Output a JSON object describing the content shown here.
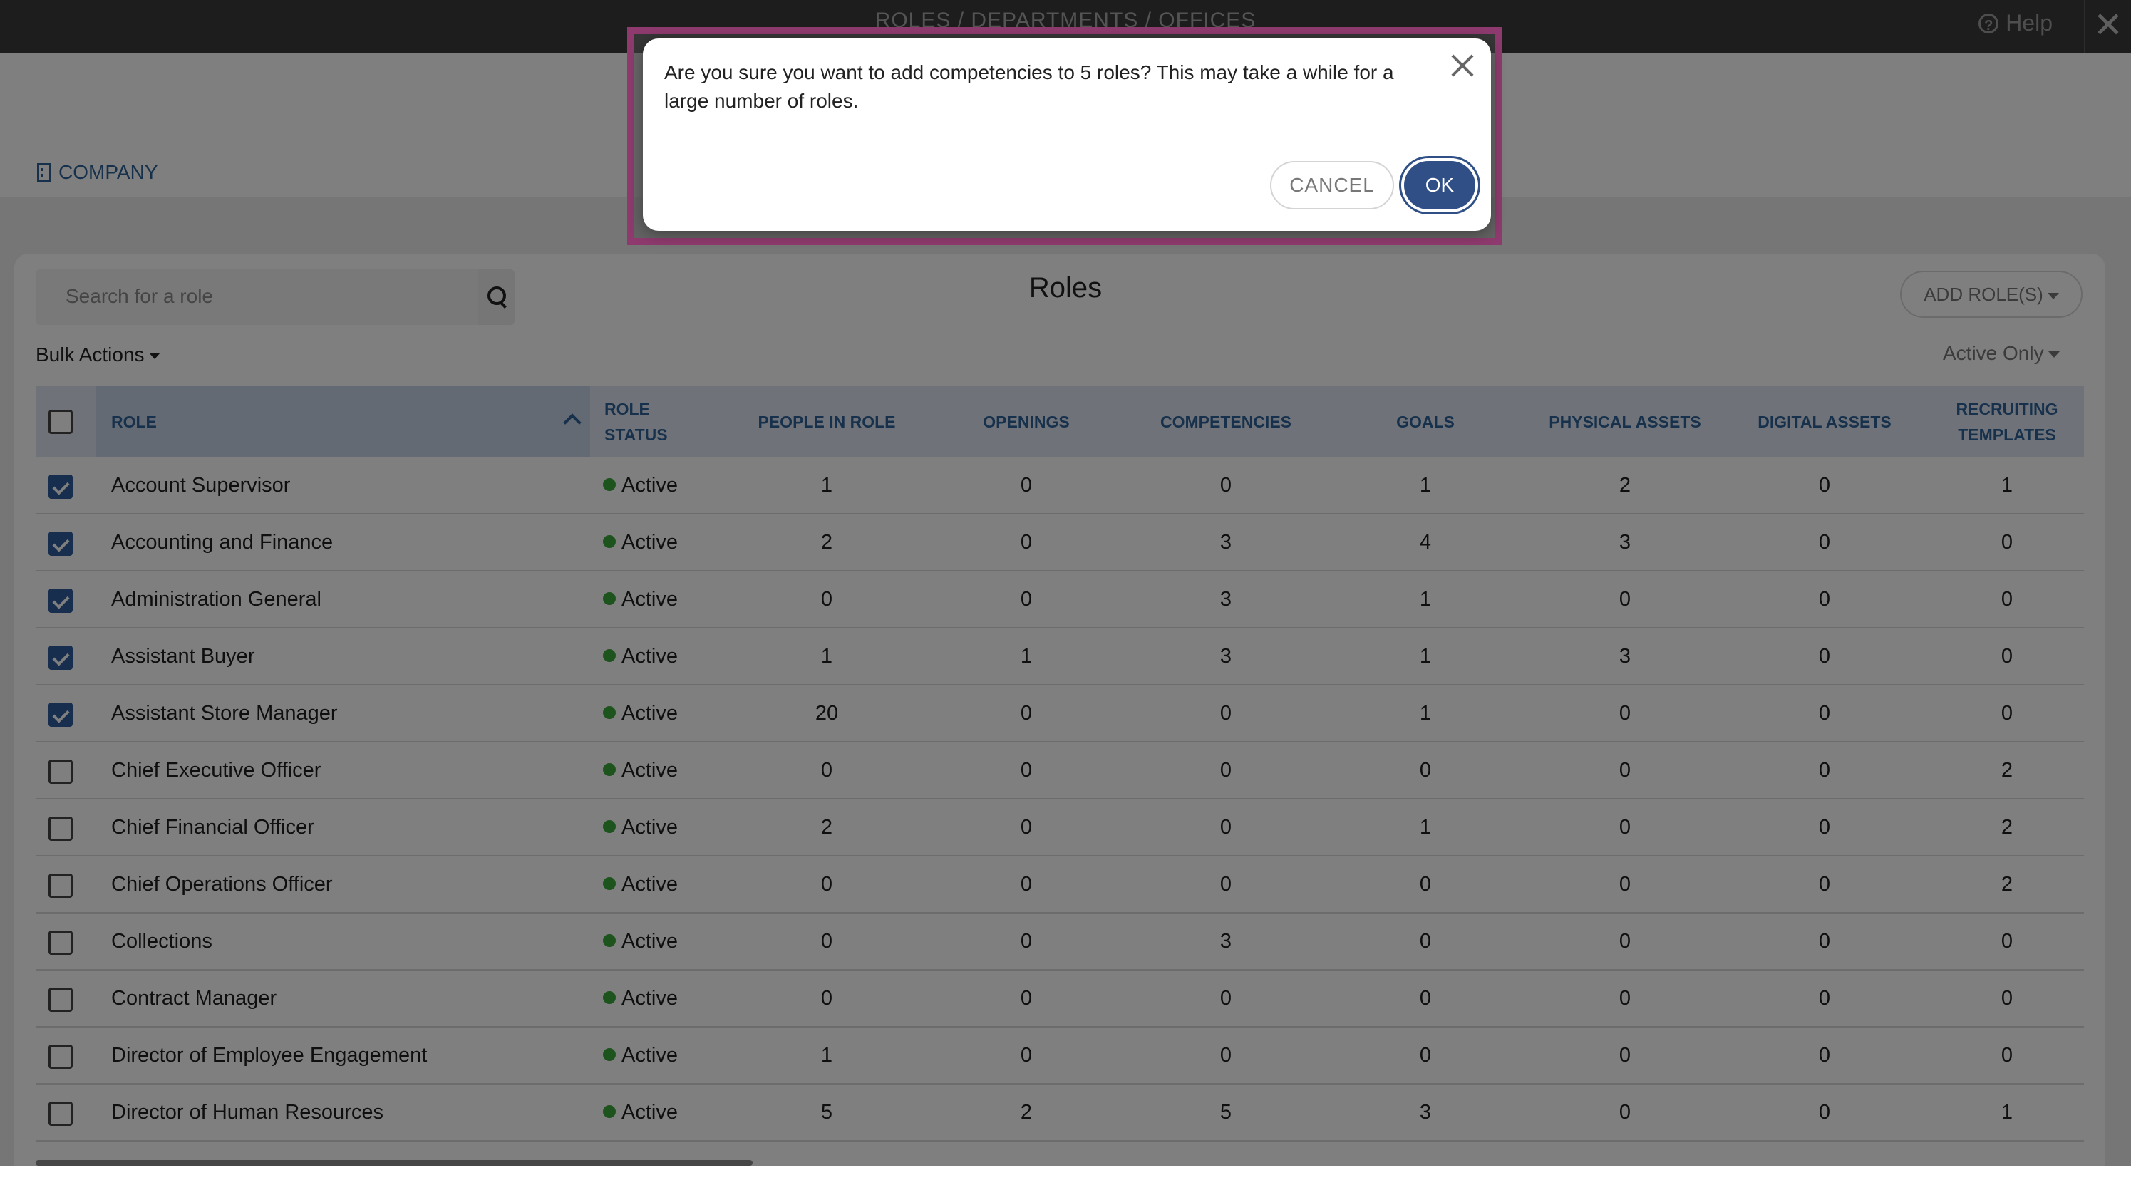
{
  "window": {
    "title": "ROLES / DEPARTMENTS / OFFICES",
    "help_label": "Help",
    "close_glyph": "✕"
  },
  "company_bar": {
    "label": "COMPANY",
    "icon": "building-icon"
  },
  "search": {
    "placeholder": "Search for a role",
    "icon": "search-icon"
  },
  "main": {
    "title": "Roles",
    "add_role_label": "ADD ROLE(S)",
    "bulk_actions_label": "Bulk Actions",
    "filter_label": "Active Only"
  },
  "table": {
    "headers": {
      "role": "ROLE",
      "role_status": "ROLE STATUS",
      "people_in_role": "PEOPLE IN ROLE",
      "openings": "OPENINGS",
      "competencies": "COMPETENCIES",
      "goals": "GOALS",
      "physical_assets": "PHYSICAL ASSETS",
      "digital_assets": "DIGITAL ASSETS",
      "recruiting_templates": "RECRUITING TEMPLATES"
    },
    "rows": [
      {
        "checked": true,
        "role": "Account Supervisor",
        "status": "Active",
        "people": "1",
        "openings": "0",
        "competencies": "0",
        "goals": "1",
        "physical": "2",
        "digital": "0",
        "recruiting": "1"
      },
      {
        "checked": true,
        "role": "Accounting and Finance",
        "status": "Active",
        "people": "2",
        "openings": "0",
        "competencies": "3",
        "goals": "4",
        "physical": "3",
        "digital": "0",
        "recruiting": "0"
      },
      {
        "checked": true,
        "role": "Administration General",
        "status": "Active",
        "people": "0",
        "openings": "0",
        "competencies": "3",
        "goals": "1",
        "physical": "0",
        "digital": "0",
        "recruiting": "0"
      },
      {
        "checked": true,
        "role": "Assistant Buyer",
        "status": "Active",
        "people": "1",
        "openings": "1",
        "competencies": "3",
        "goals": "1",
        "physical": "3",
        "digital": "0",
        "recruiting": "0"
      },
      {
        "checked": true,
        "role": "Assistant Store Manager",
        "status": "Active",
        "people": "20",
        "openings": "0",
        "competencies": "0",
        "goals": "1",
        "physical": "0",
        "digital": "0",
        "recruiting": "0"
      },
      {
        "checked": false,
        "role": "Chief Executive Officer",
        "status": "Active",
        "people": "0",
        "openings": "0",
        "competencies": "0",
        "goals": "0",
        "physical": "0",
        "digital": "0",
        "recruiting": "2"
      },
      {
        "checked": false,
        "role": "Chief Financial Officer",
        "status": "Active",
        "people": "2",
        "openings": "0",
        "competencies": "0",
        "goals": "1",
        "physical": "0",
        "digital": "0",
        "recruiting": "2"
      },
      {
        "checked": false,
        "role": "Chief Operations Officer",
        "status": "Active",
        "people": "0",
        "openings": "0",
        "competencies": "0",
        "goals": "0",
        "physical": "0",
        "digital": "0",
        "recruiting": "2"
      },
      {
        "checked": false,
        "role": "Collections",
        "status": "Active",
        "people": "0",
        "openings": "0",
        "competencies": "3",
        "goals": "0",
        "physical": "0",
        "digital": "0",
        "recruiting": "0"
      },
      {
        "checked": false,
        "role": "Contract Manager",
        "status": "Active",
        "people": "0",
        "openings": "0",
        "competencies": "0",
        "goals": "0",
        "physical": "0",
        "digital": "0",
        "recruiting": "0"
      },
      {
        "checked": false,
        "role": "Director of Employee Engagement",
        "status": "Active",
        "people": "1",
        "openings": "0",
        "competencies": "0",
        "goals": "0",
        "physical": "0",
        "digital": "0",
        "recruiting": "0"
      },
      {
        "checked": false,
        "role": "Director of Human Resources",
        "status": "Active",
        "people": "5",
        "openings": "2",
        "competencies": "5",
        "goals": "3",
        "physical": "0",
        "digital": "0",
        "recruiting": "1"
      }
    ]
  },
  "dialog": {
    "message": "Are you sure you want to add competencies to 5 roles? This may take a while for a large number of roles.",
    "cancel_label": "CANCEL",
    "ok_label": "OK"
  },
  "colors": {
    "accent": "#2e6399",
    "ok_button": "#2f4f86",
    "active_dot": "#3aa63a",
    "dialog_frame": "#8e3a6e"
  }
}
